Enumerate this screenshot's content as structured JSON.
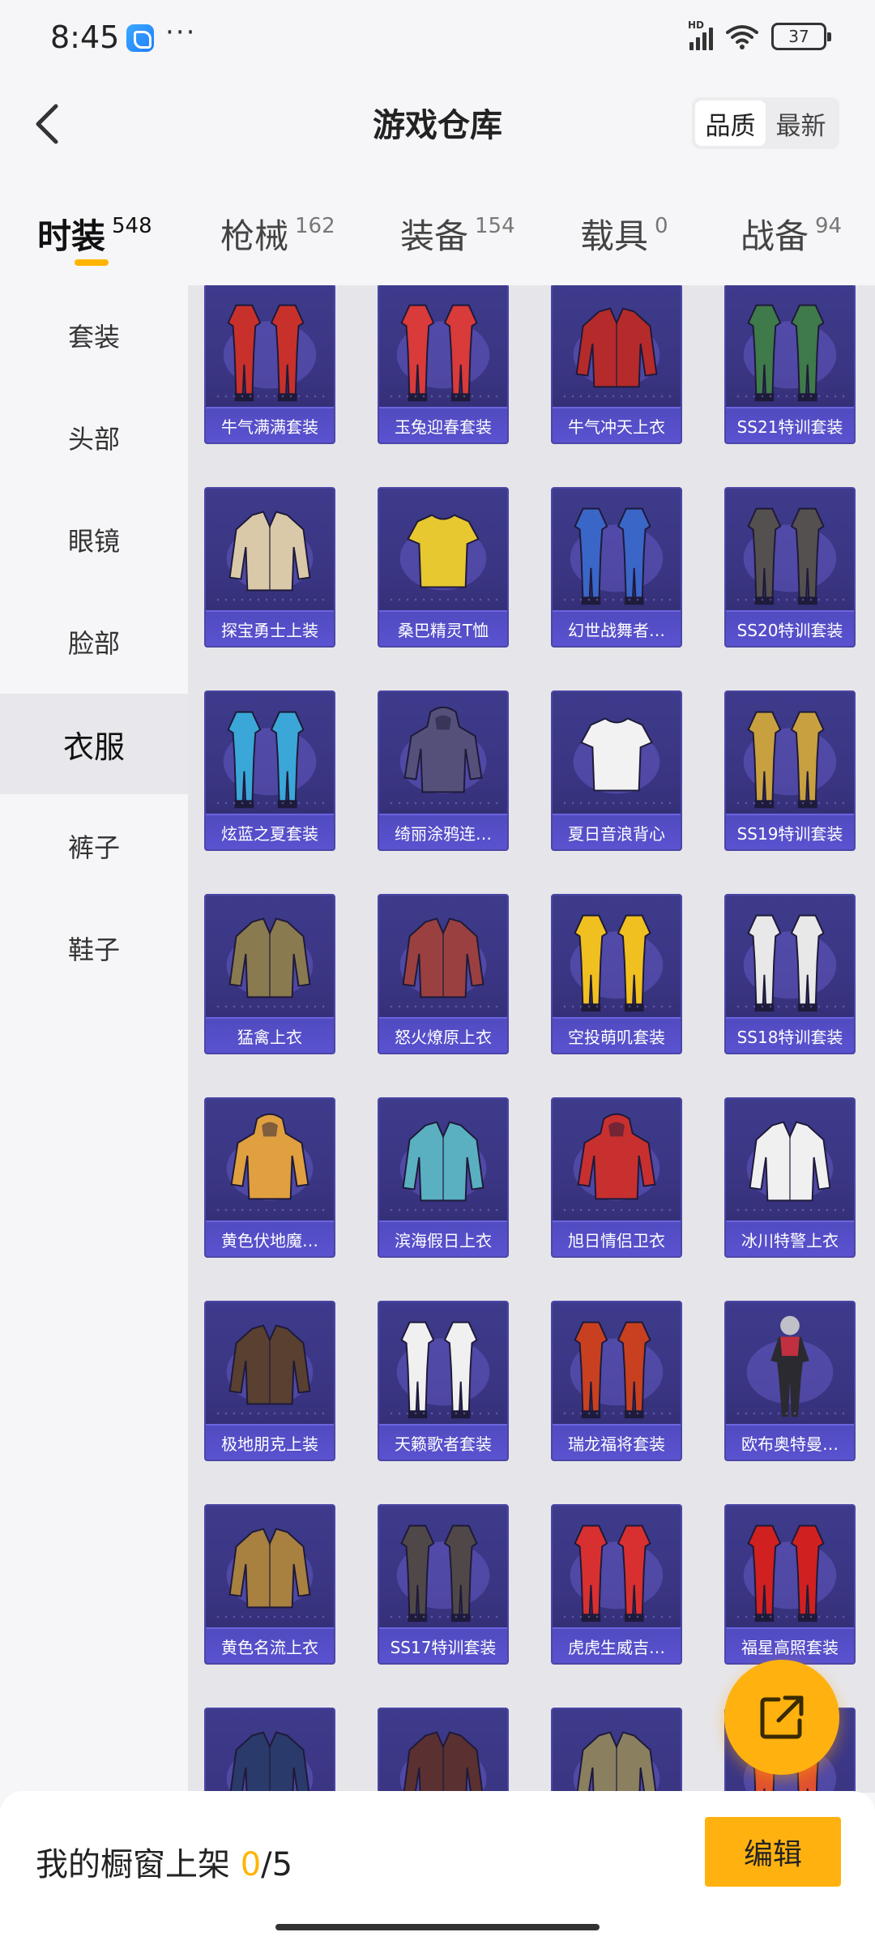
{
  "status_bar": {
    "time": "8:45",
    "battery": "37",
    "network": "HD"
  },
  "header": {
    "title": "游戏仓库",
    "sort_options": [
      "品质",
      "最新"
    ]
  },
  "tabs": [
    {
      "label": "时装",
      "count": "548"
    },
    {
      "label": "枪械",
      "count": "162"
    },
    {
      "label": "装备",
      "count": "154"
    },
    {
      "label": "载具",
      "count": "0"
    },
    {
      "label": "战备",
      "count": "94"
    }
  ],
  "sidebar": {
    "items": [
      "套装",
      "头部",
      "眼镜",
      "脸部",
      "衣服",
      "裤子",
      "鞋子"
    ]
  },
  "items": [
    {
      "name": "牛气满满套装",
      "icon": "outfit-set-icon",
      "color": "#c8302c"
    },
    {
      "name": "玉兔迎春套装",
      "icon": "outfit-set-icon",
      "color": "#d93a3a"
    },
    {
      "name": "牛气冲天上衣",
      "icon": "jacket-icon",
      "color": "#b52a2a"
    },
    {
      "name": "SS21特训套装",
      "icon": "outfit-set-icon",
      "color": "#3f7a4a"
    },
    {
      "name": "探宝勇士上装",
      "icon": "jacket-icon",
      "color": "#d9c9a8"
    },
    {
      "name": "桑巴精灵T恤",
      "icon": "tshirt-icon",
      "color": "#e8c830"
    },
    {
      "name": "幻世战舞者…",
      "icon": "outfit-set-icon",
      "color": "#3a66c8"
    },
    {
      "name": "SS20特训套装",
      "icon": "outfit-set-icon",
      "color": "#555050"
    },
    {
      "name": "炫蓝之夏套装",
      "icon": "outfit-set-icon",
      "color": "#3aa7d8"
    },
    {
      "name": "绮丽涂鸦连…",
      "icon": "hoodie-icon",
      "color": "#55507a"
    },
    {
      "name": "夏日音浪背心",
      "icon": "tank-top-icon",
      "color": "#f2f2f2"
    },
    {
      "name": "SS19特训套装",
      "icon": "outfit-set-icon",
      "color": "#c8a040"
    },
    {
      "name": "猛禽上衣",
      "icon": "jacket-icon",
      "color": "#8a7a50"
    },
    {
      "name": "怒火燎原上衣",
      "icon": "jacket-icon",
      "color": "#9a4040"
    },
    {
      "name": "空投萌叽套装",
      "icon": "outfit-set-icon",
      "color": "#f0c020"
    },
    {
      "name": "SS18特训套装",
      "icon": "outfit-set-icon",
      "color": "#e8e8e8"
    },
    {
      "name": "黄色伏地魔…",
      "icon": "hoodie-icon",
      "color": "#e0a040"
    },
    {
      "name": "滨海假日上衣",
      "icon": "shirt-icon",
      "color": "#5ab0c0"
    },
    {
      "name": "旭日情侣卫衣",
      "icon": "hoodie-icon",
      "color": "#c83030"
    },
    {
      "name": "冰川特警上衣",
      "icon": "jacket-icon",
      "color": "#f0f0f0"
    },
    {
      "name": "极地朋克上装",
      "icon": "jacket-icon",
      "color": "#5a4030"
    },
    {
      "name": "天籁歌者套装",
      "icon": "outfit-set-icon",
      "color": "#f0f0f0"
    },
    {
      "name": "瑞龙福将套装",
      "icon": "outfit-set-icon",
      "color": "#c84020"
    },
    {
      "name": "欧布奥特曼…",
      "icon": "bodysuit-icon",
      "color": "#c03040"
    },
    {
      "name": "黄色名流上衣",
      "icon": "blazer-icon",
      "color": "#a88040"
    },
    {
      "name": "SS17特训套装",
      "icon": "outfit-set-icon",
      "color": "#504848"
    },
    {
      "name": "虎虎生威吉…",
      "icon": "outfit-set-icon",
      "color": "#d83030"
    },
    {
      "name": "福星高照套装",
      "icon": "outfit-set-icon",
      "color": "#d02020"
    },
    {
      "name": "",
      "icon": "blazer-icon",
      "color": "#2a3a6a"
    },
    {
      "name": "",
      "icon": "blazer-icon",
      "color": "#5a3030"
    },
    {
      "name": "",
      "icon": "jacket-icon",
      "color": "#8a8060"
    },
    {
      "name": "",
      "icon": "outfit-set-icon",
      "color": "#e05030"
    }
  ],
  "bottom_bar": {
    "shelf_label": "我的橱窗上架",
    "shelf_current": "0",
    "shelf_total": "/5",
    "edit_label": "编辑"
  },
  "colors": {
    "accent": "#ffb20f",
    "card_bg": "#3a3582",
    "card_label": "#5a52d0"
  }
}
